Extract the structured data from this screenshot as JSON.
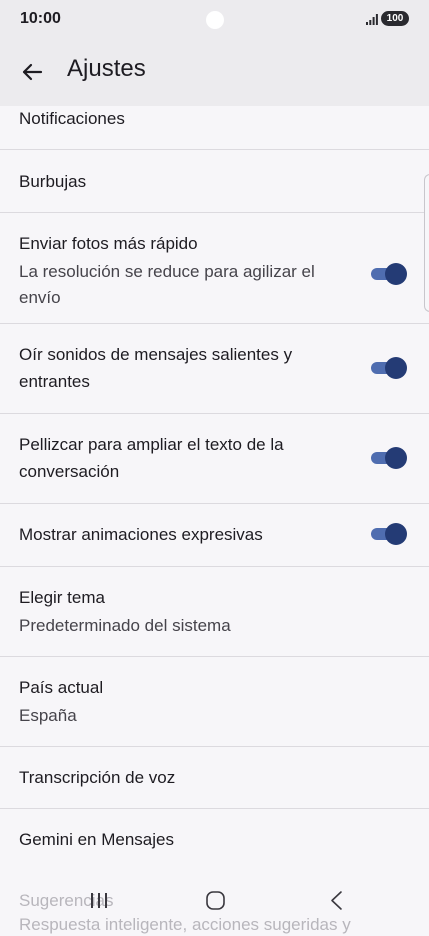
{
  "status": {
    "time": "10:00",
    "battery": "100"
  },
  "header": {
    "title": "Ajustes"
  },
  "settings": {
    "notifications": "Notificaciones",
    "bubbles": "Burbujas",
    "fast_photos": {
      "title": "Enviar fotos más rápido",
      "subtitle_line1": "La resolución se reduce para agilizar el",
      "subtitle_line2": "envío",
      "enabled": true
    },
    "sounds": {
      "title_line1": "Oír sonidos de mensajes salientes y",
      "title_line2": "entrantes",
      "enabled": true
    },
    "pinch_zoom": {
      "title_line1": "Pellizcar para ampliar el texto de la",
      "title_line2": "conversación",
      "enabled": true
    },
    "animations": {
      "title": "Mostrar animaciones expresivas",
      "enabled": true
    },
    "theme": {
      "title": "Elegir tema",
      "value": "Predeterminado del sistema"
    },
    "country": {
      "title": "País actual",
      "value": "España"
    },
    "voice": "Transcripción de voz",
    "gemini": "Gemini en Mensajes",
    "suggestions": {
      "title": "Sugerencias",
      "subtitle": "Respuesta inteligente, acciones sugeridas y"
    }
  },
  "colors": {
    "toggle_track": "#4f6db0",
    "toggle_thumb": "#243b75",
    "header_bg": "#ecebee",
    "page_bg": "#f7f6f9"
  },
  "icons": {
    "back": "arrow-back-icon",
    "recents": "recent-apps-icon",
    "home": "home-icon",
    "nav_back": "nav-back-icon"
  }
}
